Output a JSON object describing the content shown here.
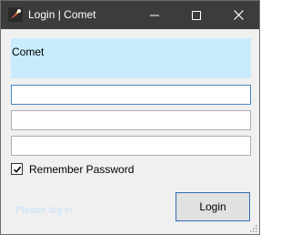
{
  "window": {
    "title": "Login | Comet",
    "controls": {
      "minimize_icon": "minimize-icon",
      "maximize_icon": "maximize-icon",
      "close_icon": "close-icon"
    }
  },
  "banner": {
    "text": "Comet",
    "background": "#c8ecfc"
  },
  "form": {
    "fields": [
      {
        "value": "",
        "placeholder": ""
      },
      {
        "value": "",
        "placeholder": ""
      },
      {
        "value": "",
        "placeholder": ""
      }
    ],
    "remember": {
      "label": "Remember Password",
      "checked": true
    },
    "status": "Please log in.",
    "login_label": "Login"
  },
  "colors": {
    "titlebar": "#3c3c3c",
    "status_text": "#c8e2f8",
    "focus_border": "#4a86c5",
    "button_border": "#2f6db1"
  }
}
